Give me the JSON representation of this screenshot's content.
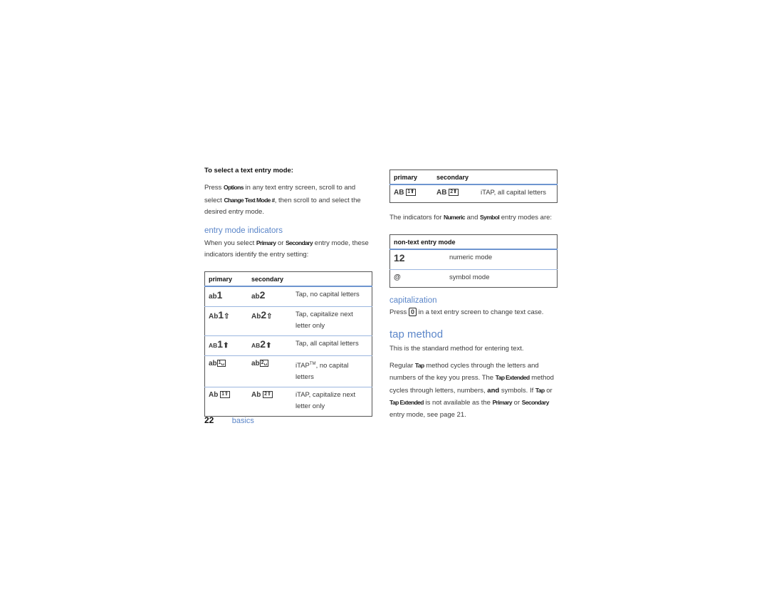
{
  "left": {
    "heading": "To select a text entry mode:",
    "para1": {
      "t1": "Press ",
      "b1": "Options",
      "t2": " in any text entry screen, scroll to and select ",
      "b2": "Change Text Mode #",
      "t3": ", then scroll to and select the desired entry mode."
    },
    "section_title": "entry mode indicators",
    "para2": {
      "t1": "When you select ",
      "b1": "Primary",
      "t2": " or ",
      "b2": "Secondary",
      "t3": " entry mode, these indicators identify the entry setting:"
    },
    "table": {
      "headers": [
        "primary",
        "secondary",
        ""
      ],
      "rows": [
        {
          "primary_prefix": "ab",
          "primary_num": "1",
          "primary_suffix": "",
          "secondary_prefix": "ab",
          "secondary_num": "2",
          "secondary_suffix": "",
          "desc": "Tap, no capital letters"
        },
        {
          "primary_prefix": "Ab",
          "primary_num": "1",
          "primary_suffix": "⇧",
          "secondary_prefix": "Ab",
          "secondary_num": "2",
          "secondary_suffix": "⇧",
          "desc": "Tap, capitalize next letter only"
        },
        {
          "primary_prefix": "AB",
          "primary_num": "1",
          "primary_suffix": "⬆",
          "secondary_prefix": "AB",
          "secondary_num": "2",
          "secondary_suffix": "⬆",
          "desc": "Tap, all capital letters"
        },
        {
          "primary_prefix": "ab",
          "primary_key": "1␣",
          "secondary_prefix": "ab",
          "secondary_key": "2␣",
          "desc": "iTAP",
          "desc_sup": "TM",
          "desc_rest": ", no capital letters"
        },
        {
          "primary_prefix": "Ab ",
          "primary_key": "1⇧",
          "secondary_prefix": "Ab ",
          "secondary_key": "2⇧",
          "desc": "iTAP, capitalize next letter only"
        }
      ]
    }
  },
  "right": {
    "table1": {
      "headers": [
        "primary",
        "secondary",
        ""
      ],
      "rows": [
        {
          "primary_prefix": "AB ",
          "primary_key": "1⬆",
          "secondary_prefix": "AB ",
          "secondary_key": "2⬆",
          "desc": "iTAP, all capital letters"
        }
      ]
    },
    "para1": {
      "t1": "The indicators for ",
      "b1": "Numeric",
      "t2": " and ",
      "b2": "Symbol",
      "t3": " entry modes are:"
    },
    "table2": {
      "header": "non-text entry mode",
      "rows": [
        {
          "indicator": "12",
          "desc": "numeric mode"
        },
        {
          "indicator": "@",
          "desc": "symbol mode"
        }
      ]
    },
    "cap_title": "capitalization",
    "cap_para": {
      "t1": "Press ",
      "key": "0",
      "t2": " in a text entry screen to change text case."
    },
    "tap_title": "tap method",
    "tap_para1": "This is the standard method for entering text.",
    "tap_para2": {
      "t1": "Regular ",
      "b1": "Tap",
      "t2": " method cycles through the letters and numbers of the key you press. The ",
      "b2": "Tap Extended",
      "t3": " method cycles through letters, numbers, ",
      "b3": "and",
      "t4": " symbols. If ",
      "b4": "Tap",
      "t5": " or ",
      "b5": "Tap Extended",
      "t6": " is not available as the ",
      "b6": "Primary",
      "t7": " or ",
      "b7": "Secondary",
      "t8": " entry mode, see page 21."
    }
  },
  "footer": {
    "page_number": "22",
    "section": "basics"
  },
  "colors": {
    "accent": "#5b86c9",
    "rule": "#6e95cf"
  }
}
